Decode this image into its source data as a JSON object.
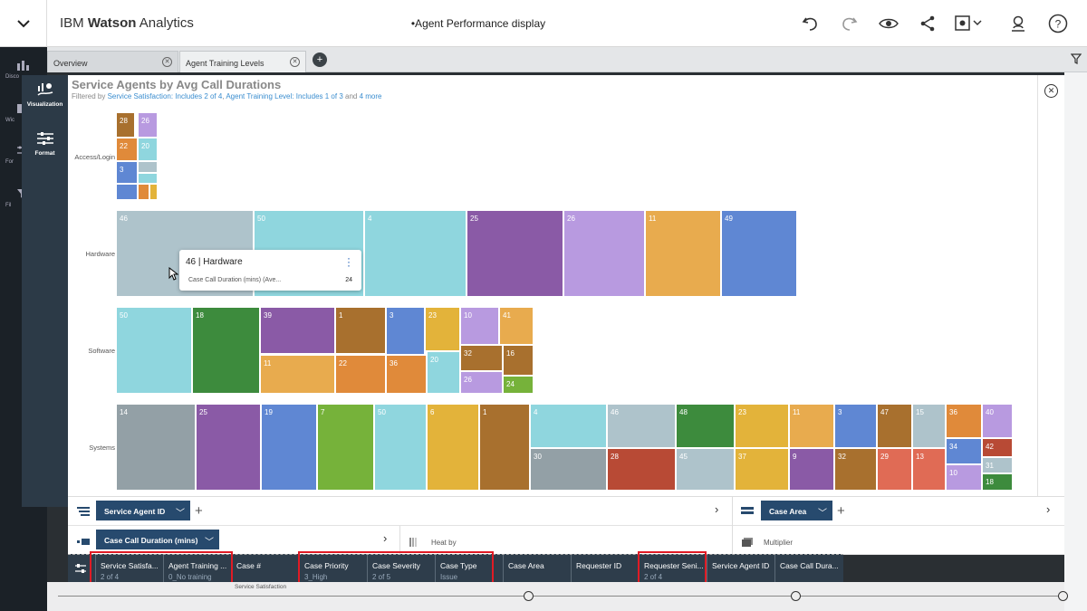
{
  "app": {
    "brand_prefix": "IBM",
    "brand_name": "Watson",
    "brand_suffix": "Analytics",
    "doc_title": "•Agent Performance display"
  },
  "toolbar": {
    "icons": [
      "undo-icon",
      "redo-icon",
      "preview-icon",
      "share-icon",
      "settings-icon",
      "user-icon",
      "help-icon"
    ]
  },
  "tabs": [
    {
      "label": "Overview"
    },
    {
      "label": "Agent Training Levels"
    }
  ],
  "leftnav": [
    {
      "label": "Disco"
    },
    {
      "label": "Wic"
    },
    {
      "label": "For"
    },
    {
      "label": "Fil"
    }
  ],
  "vispanel": {
    "visualization": "Visualization",
    "format": "Format"
  },
  "chart": {
    "title": "Service Agents by Avg Call Durations",
    "subtitle_prefix": "Filtered by",
    "filter1": "Service Satisfaction: Includes 2 of 4",
    "sep": ",",
    "filter2": "Agent Training Level: Includes 1 of 3",
    "and": "and",
    "more": "4 more"
  },
  "chart_data": {
    "type": "treemap",
    "groups": [
      {
        "name": "Access/Login",
        "labels": [
          "28",
          "26",
          "22",
          "20",
          "3",
          "",
          "",
          "",
          "",
          ""
        ]
      },
      {
        "name": "Hardware",
        "labels": [
          "46",
          "50",
          "4",
          "25",
          "26",
          "11",
          "49"
        ]
      },
      {
        "name": "Software",
        "labels": [
          "50",
          "18",
          "39",
          "1",
          "3",
          "23",
          "10",
          "41",
          "11",
          "22",
          "36",
          "20",
          "32",
          "16",
          "26",
          "24"
        ]
      },
      {
        "name": "Systems",
        "labels": [
          "14",
          "25",
          "19",
          "7",
          "50",
          "6",
          "1",
          "4",
          "46",
          "48",
          "23",
          "11",
          "3",
          "47",
          "15",
          "36",
          "40",
          "30",
          "28",
          "45",
          "37",
          "9",
          "32",
          "29",
          "13",
          "34",
          "42",
          "31",
          "10",
          "18"
        ]
      }
    ]
  },
  "tooltip": {
    "title": "46 | Hardware",
    "label": "Case Call Duration (mins) (Ave...",
    "value": "24"
  },
  "slots": {
    "rows": "Service Agent ID",
    "columns": "Case Area",
    "size": "Case Call Duration (mins)",
    "heat": "Heat by",
    "multiplier": "Multiplier"
  },
  "columns": [
    {
      "label": "Service Satisfa...",
      "sub": "2 of 4"
    },
    {
      "label": "Agent Training ...",
      "sub": "0_No training"
    },
    {
      "label": "Case #",
      "sub": ""
    },
    {
      "label": "Case Priority",
      "sub": "3_High"
    },
    {
      "label": "Case Severity",
      "sub": "2 of 5"
    },
    {
      "label": "Case Type",
      "sub": "Issue"
    },
    {
      "label": "Case Area",
      "sub": ""
    },
    {
      "label": "Requester ID",
      "sub": ""
    },
    {
      "label": "Requester Seni...",
      "sub": "2 of 4"
    },
    {
      "label": "Service Agent ID",
      "sub": ""
    },
    {
      "label": "Case Call Dura...",
      "sub": ""
    }
  ],
  "bottom": {
    "label": "Service Satisfaction"
  },
  "colors": {
    "accent": "#274a6e",
    "highlight": "#e01b25"
  }
}
